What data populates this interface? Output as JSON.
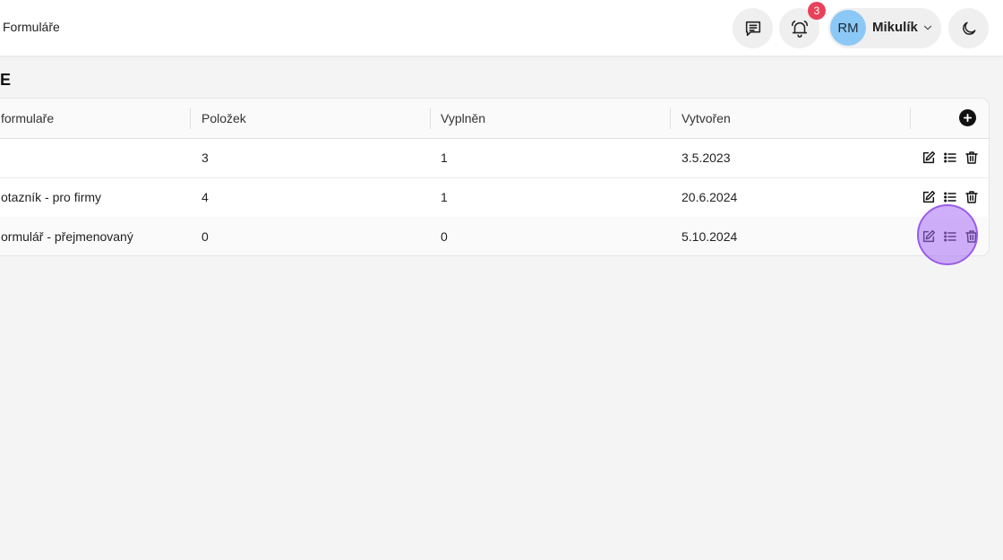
{
  "header": {
    "breadcrumb": "Formuláře",
    "notifications_count": "3",
    "user": {
      "initials": "RM",
      "name": "Mikulík"
    }
  },
  "page": {
    "heading": "E"
  },
  "table": {
    "columns": [
      "formulaře",
      "Položek",
      "Vyplněn",
      "Vytvořen"
    ],
    "rows": [
      [
        "",
        "3",
        "1",
        "3.5.2023"
      ],
      [
        "otazník - pro firmy",
        "4",
        "1",
        "20.6.2024"
      ],
      [
        "ormulář - přejmenovaný",
        "0",
        "0",
        "5.10.2024"
      ]
    ],
    "actions": [
      "edit-icon",
      "list-icon",
      "trash-icon"
    ]
  },
  "icons": {
    "messages": "chat-list-icon",
    "notifications": "bell-icon",
    "theme": "moon-icon",
    "add": "plus-circle-icon",
    "user_menu": "chevron-down-icon"
  },
  "colors": {
    "background": "#f4f4f4",
    "badge": "#e8425a",
    "avatar": "#8cc8f5",
    "click_indicator": "#9a5ce8"
  }
}
